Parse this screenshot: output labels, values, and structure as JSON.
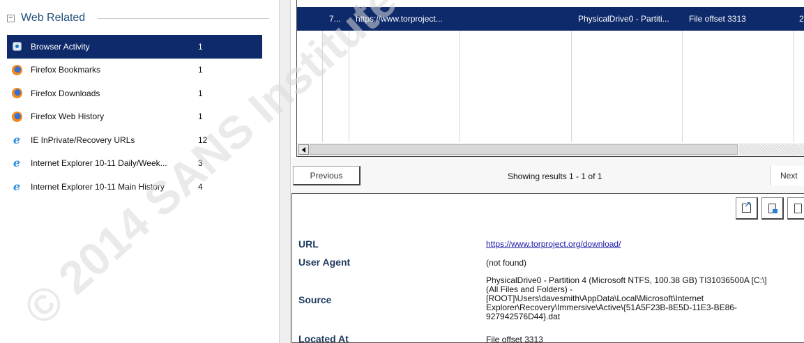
{
  "left_panel": {
    "collapse_glyph": "⊟",
    "group_title": "Web Related",
    "items": [
      {
        "label": "Browser Activity",
        "count": "1",
        "icon": "browser-activity-icon",
        "selected": true
      },
      {
        "label": "Firefox Bookmarks",
        "count": "1",
        "icon": "firefox-icon"
      },
      {
        "label": "Firefox Downloads",
        "count": "1",
        "icon": "firefox-icon"
      },
      {
        "label": "Firefox Web History",
        "count": "1",
        "icon": "firefox-icon"
      },
      {
        "label": "IE InPrivate/Recovery URLs",
        "count": "12",
        "icon": "internet-explorer-icon"
      },
      {
        "label": "Internet Explorer 10-11 Daily/Week...",
        "count": "3",
        "icon": "internet-explorer-icon"
      },
      {
        "label": "Internet Explorer 10-11 Main History",
        "count": "4",
        "icon": "internet-explorer-icon"
      }
    ]
  },
  "grid": {
    "row": {
      "id": "7...",
      "url": "https://www.torproject...",
      "source": "PhysicalDrive0 - Partiti...",
      "location": "File offset 3313",
      "extra": "2"
    }
  },
  "pager": {
    "previous_label": "Previous",
    "results_text": "Showing results 1 - 1 of 1",
    "next_label": "Next"
  },
  "details": {
    "url_key": "URL",
    "url_value": "https://www.torproject.org/download/",
    "agent_key": "User Agent",
    "agent_value": "(not found)",
    "source_key": "Source",
    "source_lines": [
      "PhysicalDrive0 - Partition 4 (Microsoft NTFS, 100.38 GB) TI31036500A [C:\\]",
      "(All Files and Folders) -",
      "[ROOT]\\Users\\davesmith\\AppData\\Local\\Microsoft\\Internet",
      "Explorer\\Recovery\\Immersive\\Active\\{51A5F23B-8E5D-11E3-BE86-",
      "927942576D44}.dat"
    ],
    "located_key": "Located At",
    "located_value": "File offset 3313"
  },
  "watermark": {
    "text": "© 2014 SANS Institute",
    "color": "#d8d8d8"
  },
  "colors": {
    "selection": "#0e2a6b",
    "group_title": "#1e4e79",
    "link": "#1a1aa6"
  }
}
